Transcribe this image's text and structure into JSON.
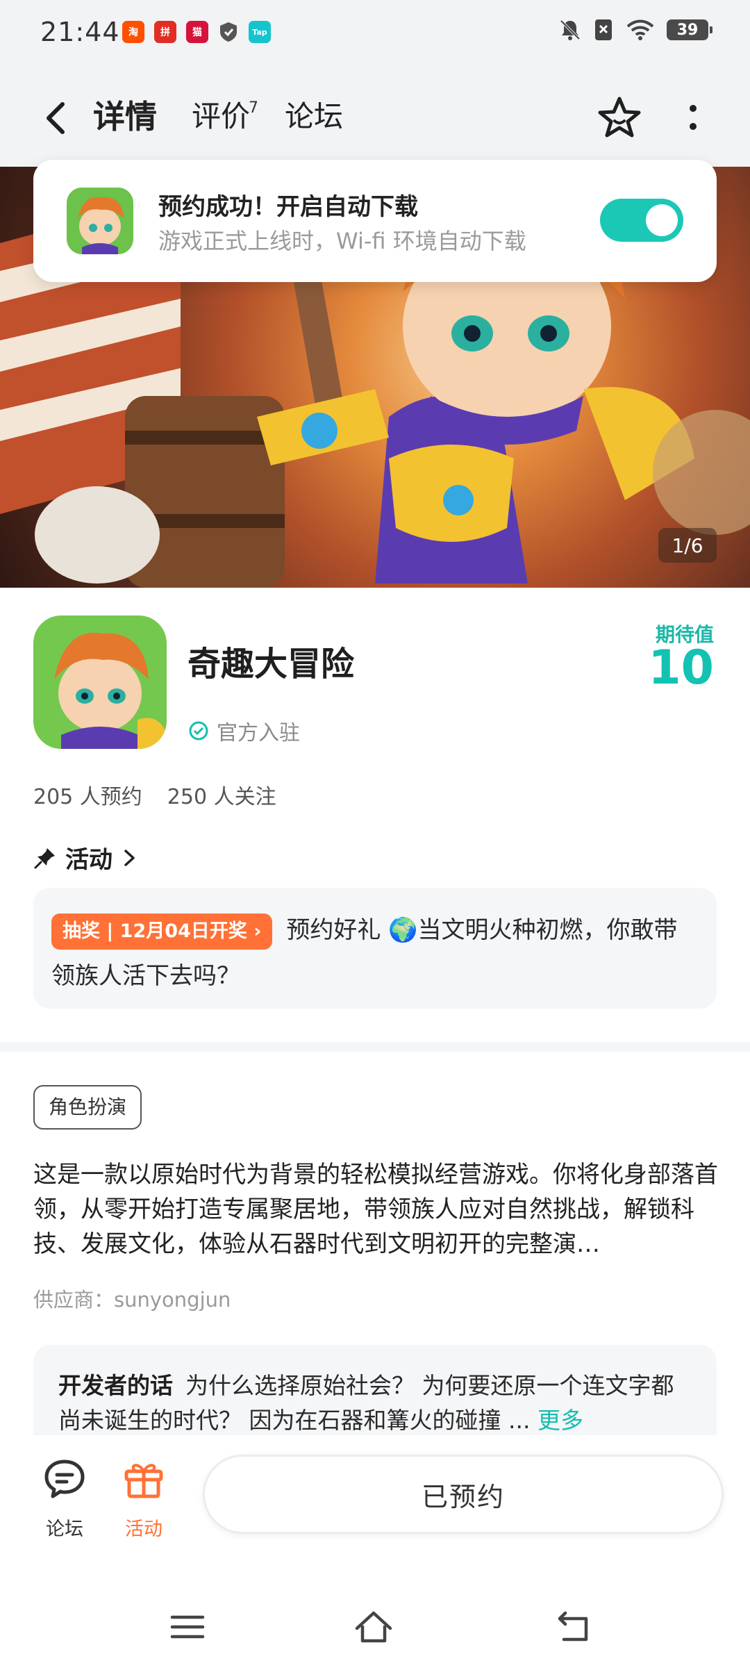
{
  "status_bar": {
    "time": "21:44",
    "battery": "39",
    "apps": [
      "淘",
      "拼",
      "猫",
      "Tap"
    ]
  },
  "nav": {
    "tabs": [
      {
        "label": "详情",
        "active": true
      },
      {
        "label": "评价",
        "badge": "7"
      },
      {
        "label": "论坛"
      }
    ]
  },
  "toast": {
    "title": "预约成功！开启自动下载",
    "subtitle": "游戏正式上线时，Wi-fi 环境自动下载",
    "toggle_on": true
  },
  "banner": {
    "counter": "1/6"
  },
  "game": {
    "name": "奇趣大冒险",
    "official": "官方入驻",
    "score_label": "期待值",
    "score": "10",
    "reservations": "205 人预约",
    "followers": "250 人关注"
  },
  "activity": {
    "heading": "活动",
    "tag": "抽奖 | 12月04日开奖",
    "text": "预约好礼 🌍当文明火种初燃，你敢带领族人活下去吗？"
  },
  "details": {
    "genre": "角色扮演",
    "description": "这是一款以原始时代为背景的轻松模拟经营游戏。你将化身部落首领，从零开始打造专属聚居地，带领族人应对自然挑战，解锁科技、发展文化，体验从石器时代到文明初开的完整演…",
    "supplier_label": "供应商：",
    "supplier": "sunyongjun",
    "dev_title": "开发者的话",
    "dev_text": "为什么选择原始社会？ 为何要还原一个连文字都尚未诞生的时代？ 因为在石器和篝火的碰撞 ...",
    "dev_more": "更多"
  },
  "bottom_bar": {
    "forum_label": "论坛",
    "activity_label": "活动",
    "reserved_label": "已预约"
  },
  "colors": {
    "accent": "#1bc8b5",
    "orange": "#ff7136"
  }
}
